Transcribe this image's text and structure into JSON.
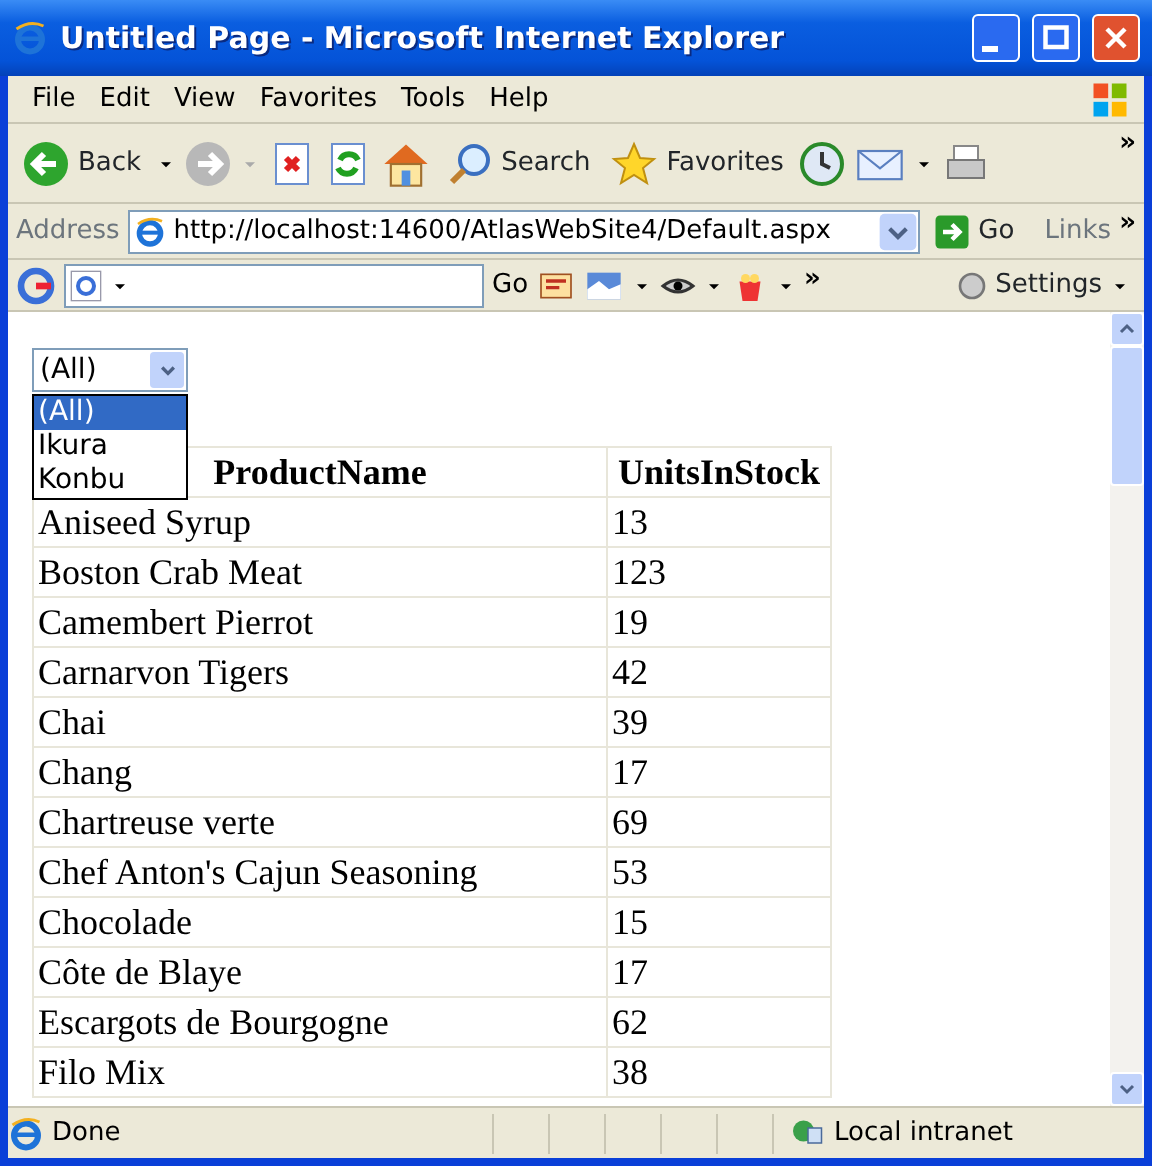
{
  "window": {
    "title": "Untitled Page - Microsoft Internet Explorer"
  },
  "menu": [
    "File",
    "Edit",
    "View",
    "Favorites",
    "Tools",
    "Help"
  ],
  "toolbar": {
    "back": "Back",
    "search": "Search",
    "favorites": "Favorites",
    "more": "»"
  },
  "address": {
    "label": "Address",
    "url": "http://localhost:14600/AtlasWebSite4/Default.aspx",
    "go": "Go",
    "links": "Links",
    "more": "»"
  },
  "google": {
    "go": "Go",
    "more": "»",
    "settings": "Settings"
  },
  "filter": {
    "value": "(All)",
    "expanded": true,
    "options": [
      {
        "label": "(All)",
        "selected": true
      },
      {
        "label": "Ikura",
        "selected": false
      },
      {
        "label": "Konbu",
        "selected": false
      }
    ]
  },
  "table": {
    "columns": [
      "ProductName",
      "UnitsInStock"
    ],
    "rows": [
      [
        "Aniseed Syrup",
        "13"
      ],
      [
        "Boston Crab Meat",
        "123"
      ],
      [
        "Camembert Pierrot",
        "19"
      ],
      [
        "Carnarvon Tigers",
        "42"
      ],
      [
        "Chai",
        "39"
      ],
      [
        "Chang",
        "17"
      ],
      [
        "Chartreuse verte",
        "69"
      ],
      [
        "Chef Anton's Cajun Seasoning",
        "53"
      ],
      [
        "Chocolade",
        "15"
      ],
      [
        "Côte de Blaye",
        "17"
      ],
      [
        "Escargots de Bourgogne",
        "62"
      ],
      [
        "Filo Mix",
        "38"
      ]
    ]
  },
  "status_bar": {
    "text": "Done",
    "zone": "Local intranet"
  }
}
